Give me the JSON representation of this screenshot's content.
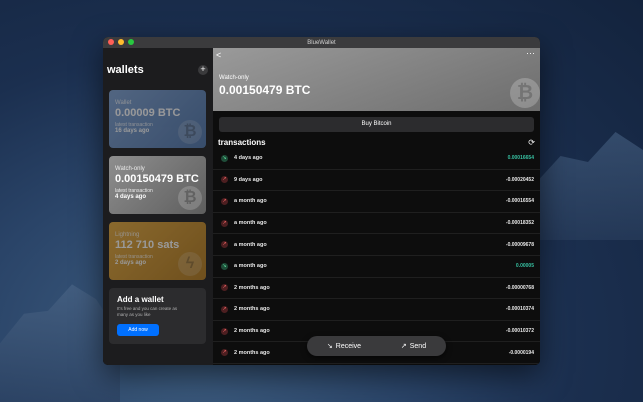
{
  "app": {
    "title": "BlueWallet"
  },
  "sidebar": {
    "title": "wallets",
    "add_symbol": "+",
    "wallets": [
      {
        "type": "Wallet",
        "balance": "0.00009 BTC",
        "latest_label": "latest transaction",
        "latest_value": "16 days ago"
      },
      {
        "type": "Watch-only",
        "balance": "0.00150479 BTC",
        "latest_label": "latest transaction",
        "latest_value": "4 days ago"
      },
      {
        "type": "Lightning",
        "balance": "112 710 sats",
        "latest_label": "latest transaction",
        "latest_value": "2 days ago"
      }
    ],
    "add_wallet": {
      "title": "Add a wallet",
      "description": "It's free and you can create as many as you like",
      "button": "Add now"
    }
  },
  "main": {
    "back_symbol": "<",
    "more_symbol": "···",
    "wallet_type": "Watch-only",
    "balance": "0.00150479 BTC",
    "buy_button": "Buy Bitcoin",
    "transactions_title": "transactions",
    "transactions": [
      {
        "time": "4 days ago",
        "amount": "0.00016654",
        "direction": "in"
      },
      {
        "time": "9 days ago",
        "amount": "-0.00020452",
        "direction": "out"
      },
      {
        "time": "a month ago",
        "amount": "-0.00016554",
        "direction": "out"
      },
      {
        "time": "a month ago",
        "amount": "-0.00018352",
        "direction": "out"
      },
      {
        "time": "a month ago",
        "amount": "-0.00009678",
        "direction": "out"
      },
      {
        "time": "a month ago",
        "amount": "0.00005",
        "direction": "in"
      },
      {
        "time": "2 months ago",
        "amount": "-0.00000768",
        "direction": "out"
      },
      {
        "time": "2 months ago",
        "amount": "-0.00010374",
        "direction": "out"
      },
      {
        "time": "2 months ago",
        "amount": "-0.00010372",
        "direction": "out"
      },
      {
        "time": "2 months ago",
        "amount": "-0.0000194",
        "direction": "out"
      }
    ],
    "receive_label": "Receive",
    "send_label": "Send"
  },
  "colors": {
    "accent": "#0070ff",
    "incoming": "#37c0a1",
    "lightning": "#e5a93b",
    "wallet_blue": "#7fa3d4"
  }
}
